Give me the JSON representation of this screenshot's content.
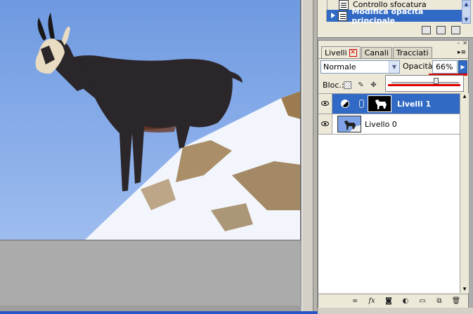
{
  "history": {
    "items": [
      {
        "label": "Controllo sfocatura"
      },
      {
        "label": "Modifica opacità principale"
      }
    ]
  },
  "layers_panel": {
    "tabs": [
      {
        "label": "Livelli"
      },
      {
        "label": "Canali"
      },
      {
        "label": "Tracciati"
      }
    ],
    "blend_mode": "Normale",
    "opacity_label": "Opacità:",
    "opacity_value": "66%",
    "lock_label": "Bloc.:",
    "layers": [
      {
        "name": "Livelli 1",
        "selected": true
      },
      {
        "name": "Livello 0",
        "selected": false
      }
    ]
  },
  "colors": {
    "selection": "#316ac5",
    "annotation_red": "#e00000",
    "panel_bg": "#ece9d8"
  }
}
